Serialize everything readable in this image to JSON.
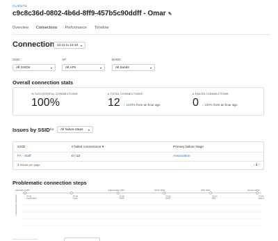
{
  "breadcrumb": "CLIENTS",
  "title": "c9c8c36d-0802-4b6d-8ff9-457b5c90ddff - Omar",
  "icons": {
    "edit": "pencil-icon",
    "dropdown": "chevron-down-icon",
    "trend_up": "arrow-up-icon",
    "trend_down": "arrow-down-icon",
    "sort": "sort-down-icon"
  },
  "tabs": [
    {
      "label": "Overview"
    },
    {
      "label": "Connections"
    },
    {
      "label": "Performance"
    },
    {
      "label": "Timeline"
    }
  ],
  "active_tab": "Connections",
  "connections": {
    "heading": "Connections",
    "time_range": "13:11 to 14:10",
    "filters": {
      "ssid": {
        "label": "SSID",
        "value": "All SSIDs"
      },
      "ap": {
        "label": "AP",
        "value": "All APs"
      },
      "band": {
        "label": "BAND",
        "value": "All bands"
      }
    }
  },
  "overall": {
    "heading": "Overall connection stats",
    "stats": [
      {
        "label": "% SUCCESSFUL CONNECTIONS",
        "value": "100%",
        "change": ""
      },
      {
        "label": "# TOTAL CONNECTIONS",
        "value": "12",
        "change_pct": "1100%",
        "change_text": "from an hour ago",
        "direction": "up"
      },
      {
        "label": "# FAILED CONNECTIONS",
        "value": "0",
        "change_pct": "100%",
        "change_text": "from an hour ago",
        "direction": "down"
      }
    ]
  },
  "issues": {
    "heading": "Issues by SSID",
    "for_label": "for",
    "filter_value": "All failure steps",
    "columns": [
      "SSID",
      "# failed connections",
      "Primary failure stage"
    ],
    "rows": [
      {
        "ssid": "FA - Staff",
        "failed": "0 / 12",
        "stage": "Association"
      }
    ],
    "results_per_page": "1",
    "results_label": "results per page",
    "page": "1"
  },
  "problematic": {
    "heading": "Problematic connection steps",
    "steps": [
      {
        "top_label": "Association 100%",
        "bottom_label": "0% fail\n0 connections"
      },
      {
        "top_label": "",
        "bottom_label": "0% fail\n0 auth"
      },
      {
        "top_label": "Authentication 100%",
        "bottom_label": "0% fail\n0 EAP"
      },
      {
        "top_label": "DHCP 100%",
        "bottom_label": "0% fail\nDHCP"
      },
      {
        "top_label": "DNS 100%",
        "bottom_label": "0% fail\nDNS"
      },
      {
        "top_label": "Success 100%",
        "bottom_label": "0% fail\npass clients"
      }
    ],
    "y_axis_label": "# unsuccessful connections"
  },
  "bottom": {
    "select_value": ""
  },
  "colors": {
    "accent": "#2b6fb6",
    "positive": "#2e8b3a"
  }
}
